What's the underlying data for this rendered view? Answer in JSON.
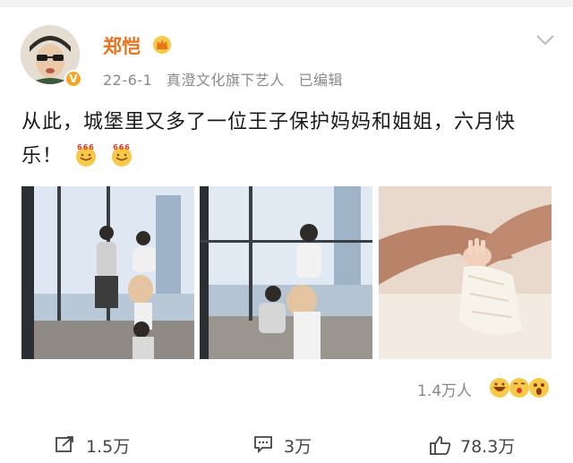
{
  "user": {
    "name": "郑恺",
    "badge_icon": "crown-icon",
    "verified_icon": "v-badge-icon",
    "verified_label": "V"
  },
  "meta": {
    "date": "22-6-1",
    "source": "真澄文化旗下艺人",
    "edited": "已编辑"
  },
  "post": {
    "text": "从此，城堡里又多了一位王子保护妈妈和姐姐，六月快乐！",
    "emoji_icons": [
      "666-emoji-icon",
      "666-emoji-icon"
    ]
  },
  "photos": [
    {
      "name": "family-window-photo"
    },
    {
      "name": "mother-child-window-photo"
    },
    {
      "name": "baby-hand-photo"
    }
  ],
  "stats": {
    "likers_count": "1.4万人",
    "reaction_icons": [
      "laugh-emoji-icon",
      "kiss-emoji-icon",
      "surprise-emoji-icon"
    ]
  },
  "actions": {
    "share_count": "1.5万",
    "comment_count": "3万",
    "like_count": "78.3万"
  },
  "colors": {
    "username": "#e8731a",
    "meta": "#8a8a8a",
    "verified": "#f5a623"
  }
}
